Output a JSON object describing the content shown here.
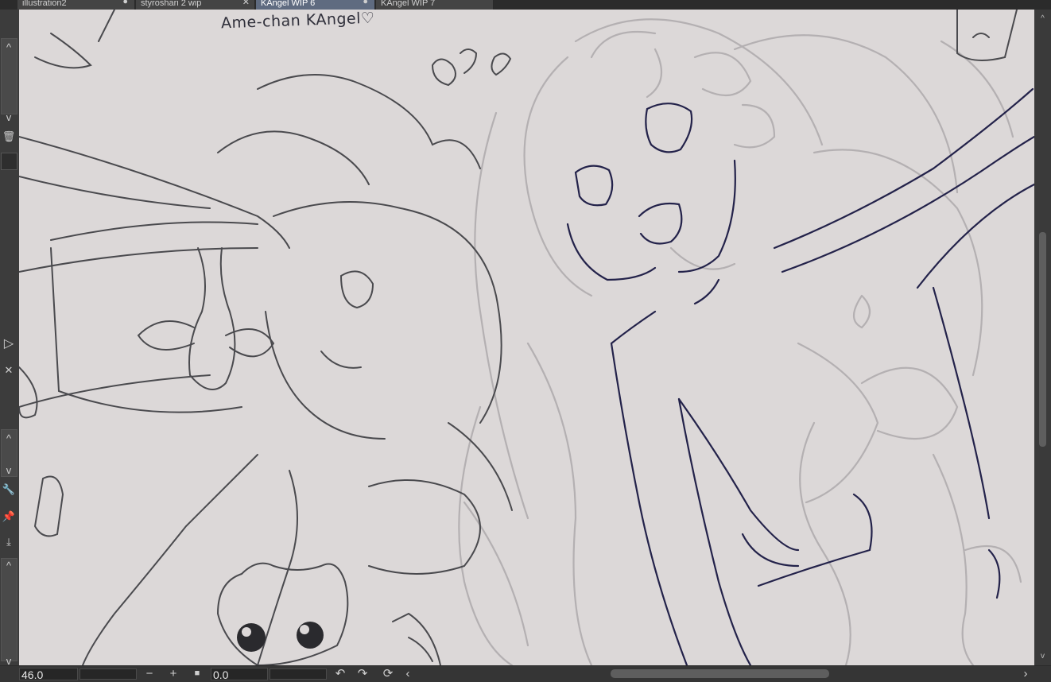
{
  "tabs": [
    {
      "label": "illustration2",
      "active": false,
      "close": "●"
    },
    {
      "label": "styroshari 2 wip",
      "active": false,
      "close": "✕"
    },
    {
      "label": "KAngel WIP 6",
      "active": true,
      "close": "●"
    },
    {
      "label": "KAngel WIP 7",
      "active": false,
      "close": ""
    }
  ],
  "canvas": {
    "caption": "Ame-chan KAngel♡",
    "background": "#dcd8d8"
  },
  "statusbar": {
    "zoom_value": "46.0",
    "rotate_value": "0.0",
    "zoom_out_icon": "minus-icon",
    "zoom_in_icon": "plus-icon",
    "fit_icon": "square-icon",
    "rotate_left_icon": "undo-icon",
    "rotate_right_icon": "redo-icon",
    "reset_icon": "reset-rotation-icon"
  },
  "icons": {
    "minus": "−",
    "plus": "+",
    "square": "■",
    "undo": "↶",
    "redo": "↷",
    "reset": "⟳",
    "left": "‹",
    "right": "›",
    "up": "^",
    "down": "v",
    "trash": "🗑",
    "play": "▷"
  }
}
